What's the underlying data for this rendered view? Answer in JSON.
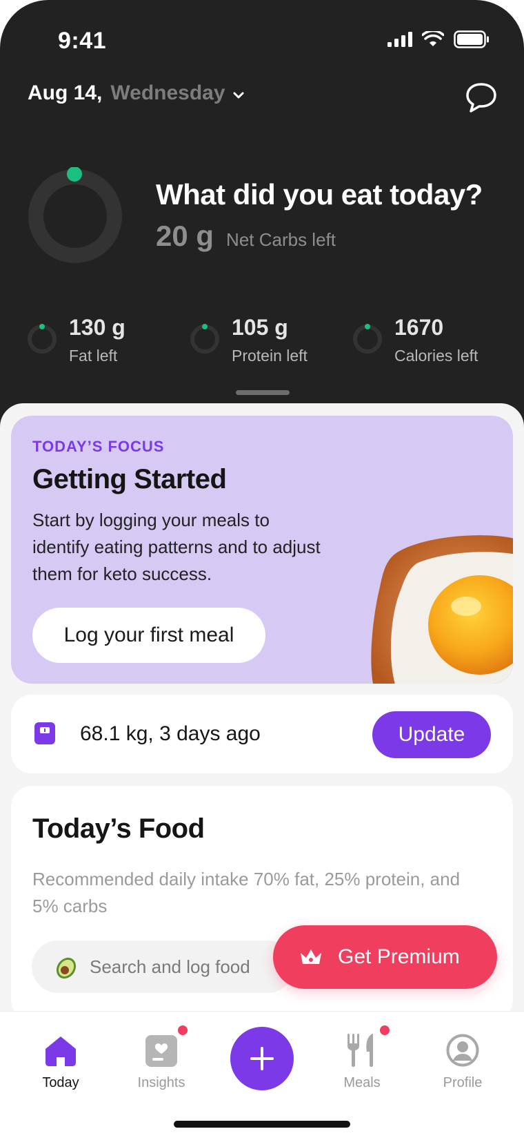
{
  "status_bar": {
    "time": "9:41"
  },
  "header": {
    "date": "Aug 14,",
    "weekday": "Wednesday"
  },
  "summary": {
    "headline": "What did you eat today?",
    "net_carbs_value": "20 g",
    "net_carbs_label": "Net Carbs left"
  },
  "macros": [
    {
      "value": "130 g",
      "label": "Fat left"
    },
    {
      "value": "105 g",
      "label": "Protein left"
    },
    {
      "value": "1670",
      "label": "Calories left"
    }
  ],
  "focus": {
    "eyebrow": "TODAY’S FOCUS",
    "title": "Getting Started",
    "description": "Start by logging your meals to identify eating patterns and to adjust them for keto success.",
    "cta": "Log your first meal"
  },
  "weight": {
    "value": "68.1 kg, 3 days ago",
    "button": "Update"
  },
  "todays_food": {
    "title": "Today’s Food",
    "description": "Recommended daily intake 70% fat, 25% protein, and 5% carbs",
    "search_placeholder": "Search and log food"
  },
  "premium": {
    "label": "Get Premium"
  },
  "tabs": [
    {
      "label": "Today",
      "icon": "home-icon",
      "active": true
    },
    {
      "label": "Insights",
      "icon": "insights-icon",
      "badge": true
    },
    {
      "label": "Meals",
      "icon": "utensils-icon",
      "badge": true
    },
    {
      "label": "Profile",
      "icon": "profile-icon"
    }
  ],
  "colors": {
    "accent": "#7b39e8",
    "premium": "#f03e5e",
    "progress_dot": "#1dbf80",
    "focus_card": "#d6c9f3",
    "header_bg": "#222222"
  }
}
